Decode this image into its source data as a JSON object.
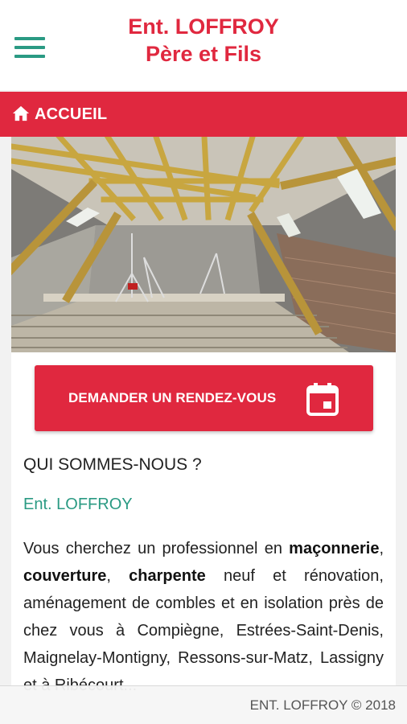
{
  "header": {
    "brand_line1": "Ent. LOFFROY",
    "brand_line2": "Père et Fils",
    "menu_icon": "hamburger-menu-icon"
  },
  "nav": {
    "home_icon": "home-icon",
    "label": "ACCUEIL"
  },
  "hero": {
    "image_alt": "Attic renovation photo with wooden roof framing"
  },
  "cta": {
    "label": "DEMANDER UN RENDEZ-VOUS",
    "icon": "calendar-icon"
  },
  "about": {
    "title": "QUI SOMMES-NOUS ?",
    "company": "Ent. LOFFROY",
    "text_1": "Vous cherchez un professionnel en ",
    "bold_1": "maçonnerie",
    "sep_1": ", ",
    "bold_2": "couverture",
    "sep_2": ", ",
    "bold_3": "charpente",
    "text_2": " neuf et rénovation, aménagement de combles et en isolation près de chez vous à Compiègne, Estrées-Saint-Denis, Maignelay-Montigny, Ressons-sur-Matz, Lassigny et à Ribécourt..."
  },
  "footer": {
    "text": "ENT. LOFFROY © 2018"
  },
  "colors": {
    "accent_red": "#e0283f",
    "accent_green": "#2a9a83",
    "background": "#f2f2f2"
  }
}
